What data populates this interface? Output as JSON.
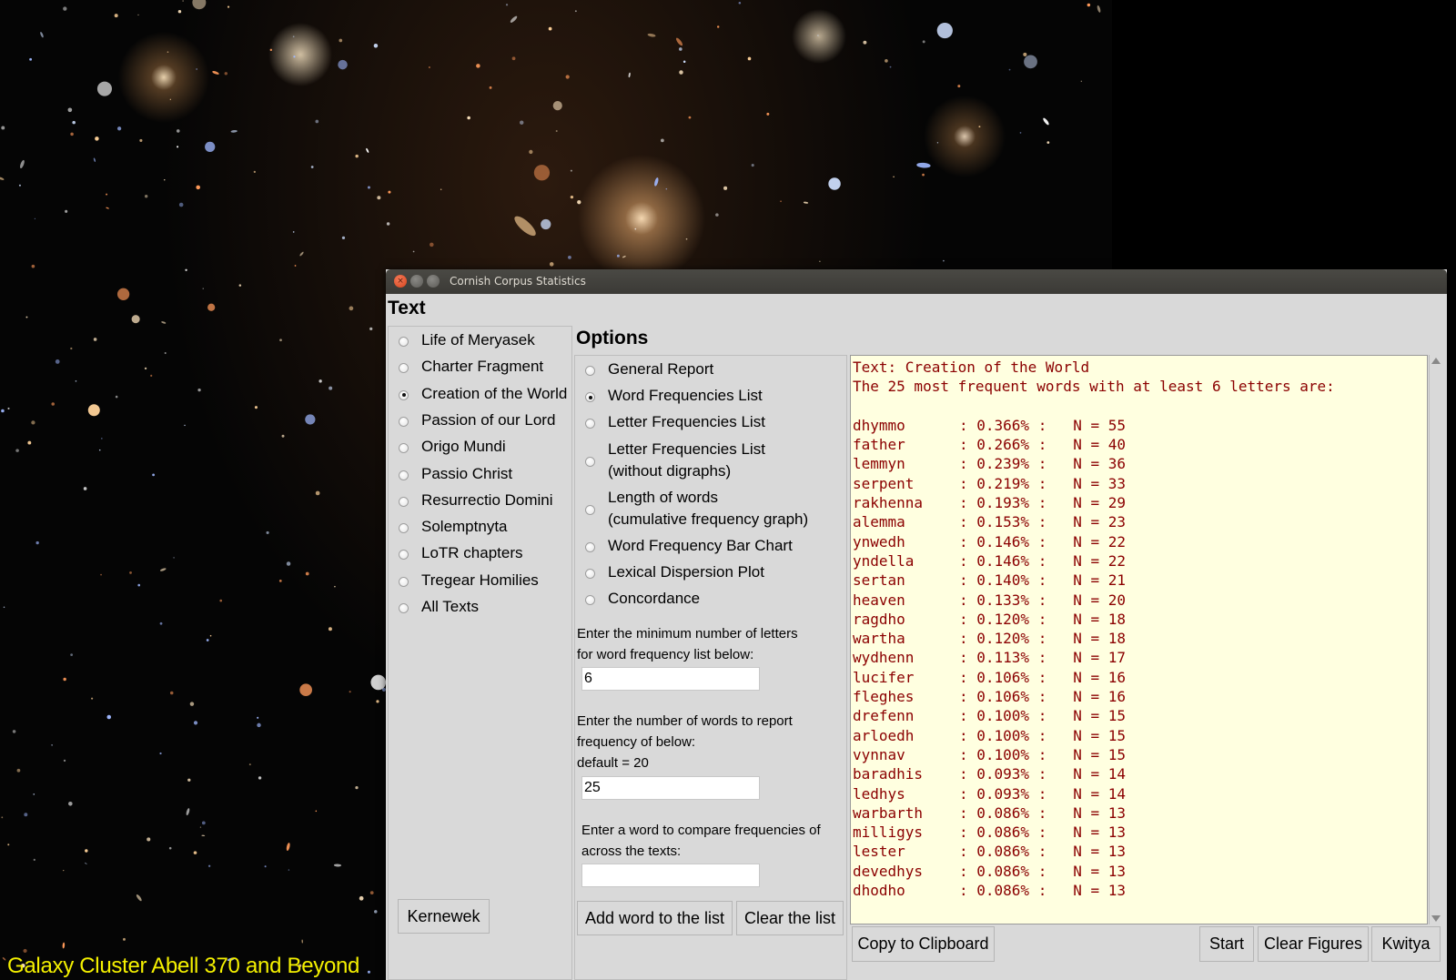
{
  "desktop": {
    "caption": "Galaxy Cluster Abell 370 and Beyond",
    "caption_color": "#f4f000"
  },
  "window": {
    "title": "Cornish Corpus Statistics",
    "close_glyph": "×",
    "min_glyph": "–",
    "max_glyph": "□"
  },
  "text_panel": {
    "heading": "Text",
    "items": [
      {
        "label": "Life of Meryasek",
        "selected": false
      },
      {
        "label": "Charter Fragment",
        "selected": false
      },
      {
        "label": "Creation of the World",
        "selected": true
      },
      {
        "label": "Passion of our Lord",
        "selected": false
      },
      {
        "label": "Origo Mundi",
        "selected": false
      },
      {
        "label": "Passio Christ",
        "selected": false
      },
      {
        "label": "Resurrectio Domini",
        "selected": false
      },
      {
        "label": "Solemptnyta",
        "selected": false
      },
      {
        "label": "LoTR chapters",
        "selected": false
      },
      {
        "label": "Tregear Homilies",
        "selected": false
      },
      {
        "label": "All Texts",
        "selected": false
      }
    ],
    "kernewek_button": "Kernewek"
  },
  "options_panel": {
    "heading": "Options",
    "items": [
      {
        "label": "General Report",
        "selected": false
      },
      {
        "label": "Word Frequencies List",
        "selected": true
      },
      {
        "label": "Letter Frequencies List",
        "selected": false
      },
      {
        "label": "Letter Frequencies List\n(without digraphs)",
        "selected": false
      },
      {
        "label": "Length of words\n(cumulative frequency graph)",
        "selected": false
      },
      {
        "label": "Word Frequency Bar Chart",
        "selected": false
      },
      {
        "label": "Lexical Dispersion Plot",
        "selected": false
      },
      {
        "label": "Concordance",
        "selected": false
      }
    ],
    "min_letters_desc": "Enter the minimum number of letters\nfor word frequency list below:",
    "min_letters_value": "6",
    "num_words_desc": "Enter the number of words to report\nfrequency of below:\ndefault = 20",
    "num_words_value": "25",
    "compare_desc": "Enter a word to compare frequencies of\nacross the texts:",
    "compare_value": "",
    "add_word_button": "Add word to the list",
    "clear_list_button": "Clear the list"
  },
  "output": {
    "header_line1": "Text: Creation of the World",
    "header_line2": "The 25 most frequent words with at least 6 letters are:",
    "rows": [
      {
        "word": "dhymmo",
        "pct": "0.366%",
        "n": "55"
      },
      {
        "word": "father",
        "pct": "0.266%",
        "n": "40"
      },
      {
        "word": "lemmyn",
        "pct": "0.239%",
        "n": "36"
      },
      {
        "word": "serpent",
        "pct": "0.219%",
        "n": "33"
      },
      {
        "word": "rakhenna",
        "pct": "0.193%",
        "n": "29"
      },
      {
        "word": "alemma",
        "pct": "0.153%",
        "n": "23"
      },
      {
        "word": "ynwedh",
        "pct": "0.146%",
        "n": "22"
      },
      {
        "word": "yndella",
        "pct": "0.146%",
        "n": "22"
      },
      {
        "word": "sertan",
        "pct": "0.140%",
        "n": "21"
      },
      {
        "word": "heaven",
        "pct": "0.133%",
        "n": "20"
      },
      {
        "word": "ragdho",
        "pct": "0.120%",
        "n": "18"
      },
      {
        "word": "wartha",
        "pct": "0.120%",
        "n": "18"
      },
      {
        "word": "wydhenn",
        "pct": "0.113%",
        "n": "17"
      },
      {
        "word": "lucifer",
        "pct": "0.106%",
        "n": "16"
      },
      {
        "word": "fleghes",
        "pct": "0.106%",
        "n": "16"
      },
      {
        "word": "drefenn",
        "pct": "0.100%",
        "n": "15"
      },
      {
        "word": "arloedh",
        "pct": "0.100%",
        "n": "15"
      },
      {
        "word": "vynnav",
        "pct": "0.100%",
        "n": "15"
      },
      {
        "word": "baradhis",
        "pct": "0.093%",
        "n": "14"
      },
      {
        "word": "ledhys",
        "pct": "0.093%",
        "n": "14"
      },
      {
        "word": "warbarth",
        "pct": "0.086%",
        "n": "13"
      },
      {
        "word": "milligys",
        "pct": "0.086%",
        "n": "13"
      },
      {
        "word": "lester",
        "pct": "0.086%",
        "n": "13"
      },
      {
        "word": "devedhys",
        "pct": "0.086%",
        "n": "13"
      },
      {
        "word": "dhodho",
        "pct": "0.086%",
        "n": "13"
      }
    ],
    "text_color": "#8b0000",
    "background": "#ffffe0"
  },
  "bottom_buttons": {
    "copy": "Copy to Clipboard",
    "start": "Start",
    "clear_figures": "Clear Figures",
    "kwitya": "Kwitya"
  }
}
